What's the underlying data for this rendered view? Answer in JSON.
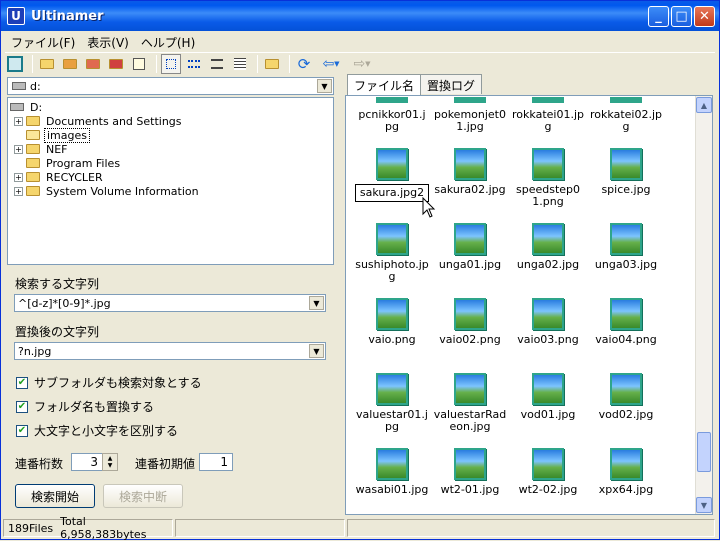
{
  "window": {
    "title": "Ultinamer",
    "app_icon_letter": "U",
    "min": "_",
    "max": "□",
    "close": "✕"
  },
  "menu": [
    {
      "label": "ファイル(F)"
    },
    {
      "label": "表示(V)"
    },
    {
      "label": "ヘルプ(H)"
    }
  ],
  "left": {
    "drive": "d:",
    "tree_root": "D:",
    "tree": [
      {
        "label": "Documents and Settings",
        "expandable": true
      },
      {
        "label": "images",
        "expandable": false,
        "selected": true
      },
      {
        "label": "NEF",
        "expandable": true
      },
      {
        "label": "Program Files",
        "expandable": false
      },
      {
        "label": "RECYCLER",
        "expandable": true
      },
      {
        "label": "System Volume Information",
        "expandable": true
      }
    ],
    "search_label": "検索する文字列",
    "search_value": "^[d-z]*[0-9]*.jpg",
    "replace_label": "置換後の文字列",
    "replace_value": "?n.jpg",
    "opt_subfolders": "サブフォルダも検索対象とする",
    "opt_foldernames": "フォルダ名も置換する",
    "opt_case": "大文字と小文字を区別する",
    "digits_label": "連番桁数",
    "digits_value": "3",
    "initial_label": "連番初期値",
    "initial_value": "1",
    "start_button": "検索開始",
    "stop_button": "検索中断"
  },
  "tabs": [
    {
      "label": "ファイル名"
    },
    {
      "label": "置換ログ"
    }
  ],
  "files": [
    {
      "name": "pcnikkor01.jpg"
    },
    {
      "name": "pokemonjet01.jpg"
    },
    {
      "name": "rokkatei01.jpg"
    },
    {
      "name": "rokkatei02.jpg"
    },
    {
      "name": "sakura.jpg2"
    },
    {
      "name": "sakura02.jpg"
    },
    {
      "name": "speedstep01.png"
    },
    {
      "name": "spice.jpg"
    },
    {
      "name": "sushiphoto.jpg"
    },
    {
      "name": "unga01.jpg"
    },
    {
      "name": "unga02.jpg"
    },
    {
      "name": "unga03.jpg"
    },
    {
      "name": "vaio.png"
    },
    {
      "name": "vaio02.png"
    },
    {
      "name": "vaio03.png"
    },
    {
      "name": "vaio04.png"
    },
    {
      "name": "valuestar01.jpg"
    },
    {
      "name": "valuestarRadeon.jpg"
    },
    {
      "name": "vod01.jpg"
    },
    {
      "name": "vod02.jpg"
    },
    {
      "name": "wasabi01.jpg"
    },
    {
      "name": "wt2-01.jpg"
    },
    {
      "name": "wt2-02.jpg"
    },
    {
      "name": "xpx64.jpg"
    }
  ],
  "status": {
    "files": "189Files",
    "total": "Total 6,958,383bytes"
  }
}
